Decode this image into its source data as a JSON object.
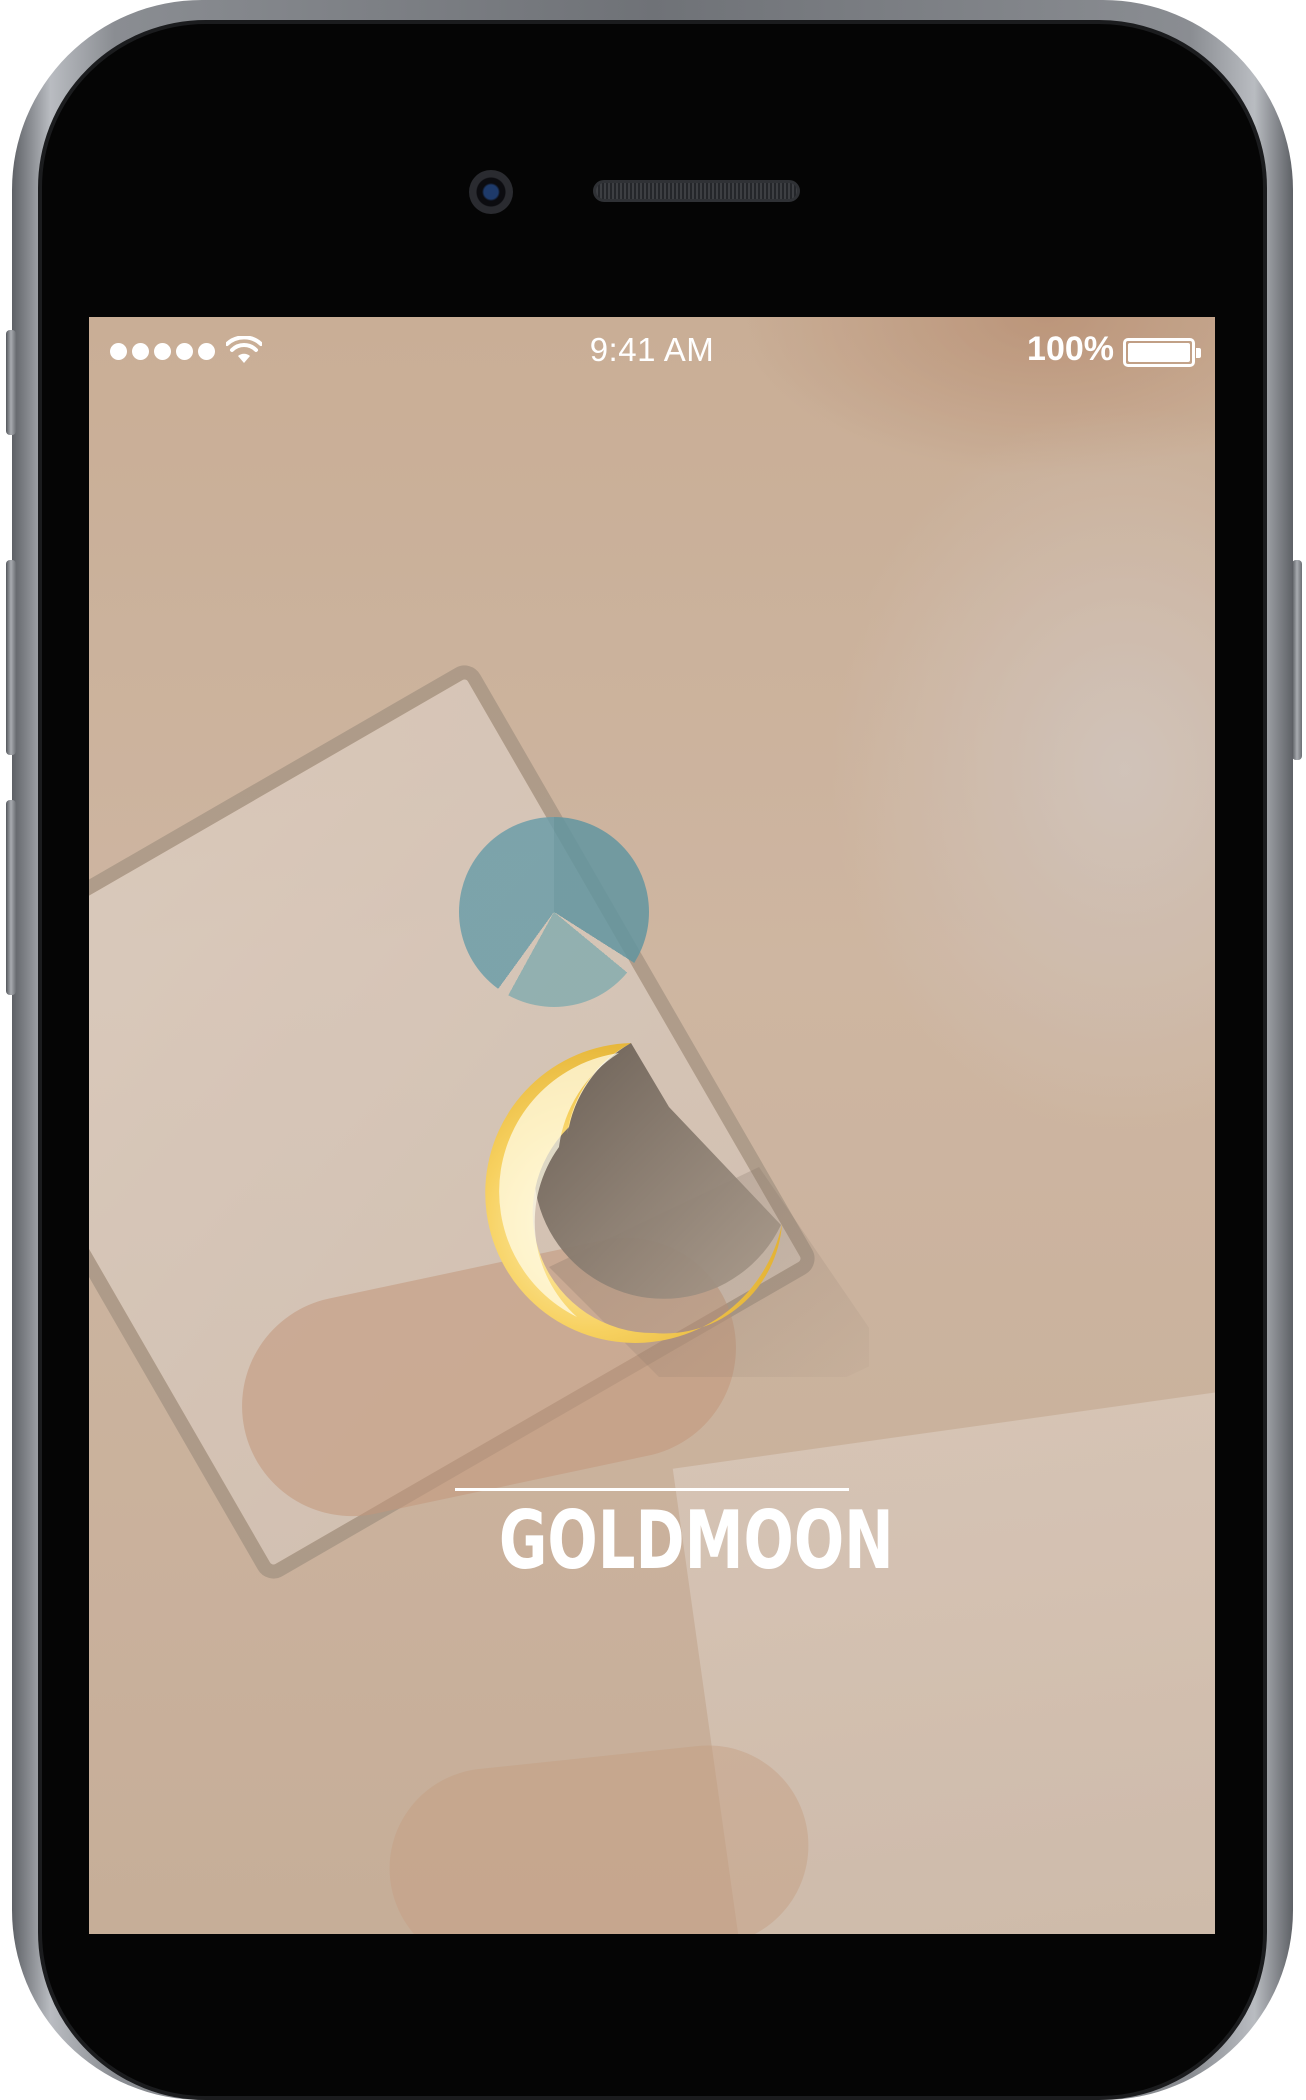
{
  "status_bar": {
    "signal_dots": 5,
    "wifi_icon": "wifi-icon",
    "time": "9:41 AM",
    "battery_percent_label": "100%",
    "battery_level": 1.0
  },
  "splash": {
    "brand_name": "GOLDMOON",
    "logo_icon": "crescent-moon-icon"
  },
  "colors": {
    "brand_gold": "#f5c542",
    "text": "#ffffff",
    "phone_frame": "#7a7d82"
  }
}
